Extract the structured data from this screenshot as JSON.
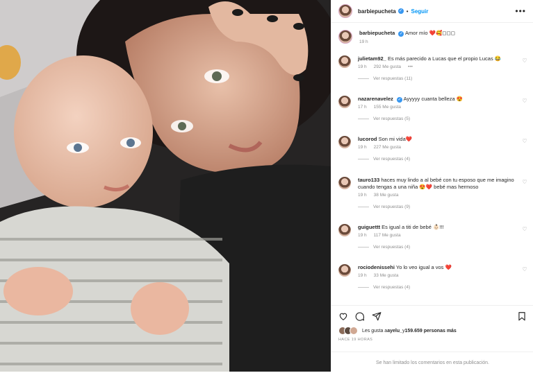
{
  "header": {
    "username": "barbiepucheta",
    "verified_mark": "✓",
    "follow": "Seguir",
    "more": "•••"
  },
  "caption": {
    "username": "barbiepucheta",
    "text": "Amor mío ❤️🥰◻◻◻",
    "time": "19 h"
  },
  "comments": [
    {
      "username": "julietam92_",
      "text": "Es más parecido a Lucas que el propio Lucas 😂",
      "time": "19 h",
      "likes": "292 Me gusta",
      "extra": "•••",
      "replies": null
    },
    {
      "username": "nazarenavelez",
      "verified": true,
      "text": "Ayyyyy cuanta belleza 😍",
      "time": "17 h",
      "likes": "155 Me gusta",
      "extra": "",
      "replies": "Ver respuestas (5)"
    },
    {
      "username": "lucorod",
      "text": "Son mi vida❤️",
      "time": "19 h",
      "likes": "227 Me gusta",
      "extra": "",
      "replies": "Ver respuestas (4)"
    },
    {
      "username": "tauro133",
      "text": "haces muy lindo a al bebé con tu esposo que me imagino cuando tengas a una niña 😍❤️ bebé mas hermoso",
      "time": "19 h",
      "likes": "38 Me gusta",
      "extra": "",
      "replies": "Ver respuestas (9)"
    },
    {
      "username": "guiguettt",
      "text": "Es igual a titi de bebé 👶🏻!!!",
      "time": "19 h",
      "likes": "117 Me gusta",
      "extra": "",
      "replies": "Ver respuestas (4)"
    },
    {
      "username": "rociodenissehi",
      "text": "Yo lo veo igual a vos ❤️",
      "time": "19 h",
      "likes": "33 Me gusta",
      "extra": "",
      "replies": "Ver respuestas (4)"
    }
  ],
  "first_replies": "Ver respuestas (11)",
  "likes_line": {
    "prefix": "Les gusta a ",
    "user": "ayelu_",
    "mid": " y ",
    "count": "159.659 personas más"
  },
  "ago": "HACE 19 HORAS",
  "limited": "Se han limitado los comentarios en esta publicación.",
  "icons": [
    "heart-icon",
    "comment-icon",
    "share-icon",
    "bookmark-icon"
  ]
}
